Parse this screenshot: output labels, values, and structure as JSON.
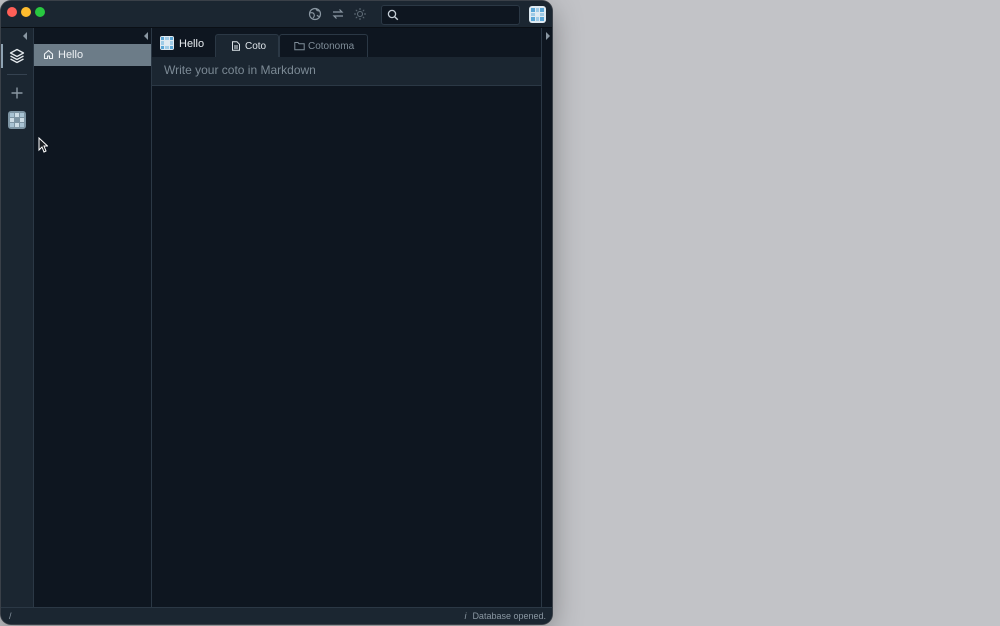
{
  "titlebar": {
    "icons": [
      "globe-icon",
      "sync-arrows-icon",
      "sun-icon"
    ],
    "search": {
      "placeholder": "",
      "value": ""
    }
  },
  "rail": {
    "icons": [
      "layers-icon",
      "plus-icon",
      "cotonoma-avatar"
    ]
  },
  "nav": {
    "items": [
      {
        "label": "Hello",
        "icon": "home-icon",
        "selected": true
      }
    ]
  },
  "main": {
    "home_label": "Hello",
    "tabs": [
      {
        "label": "Coto",
        "icon": "document-icon",
        "active": true
      },
      {
        "label": "Cotonoma",
        "icon": "folder-icon",
        "active": false
      }
    ],
    "editor": {
      "placeholder": "Write your coto in Markdown",
      "value": ""
    }
  },
  "status": {
    "path": "/",
    "info_glyph": "i",
    "message": "Database opened."
  },
  "colors": {
    "window_bg": "#0e1620",
    "chrome_bg": "#1b2631",
    "selected_item": "#6c7c88",
    "desktop_bg": "#c2c3c7"
  }
}
